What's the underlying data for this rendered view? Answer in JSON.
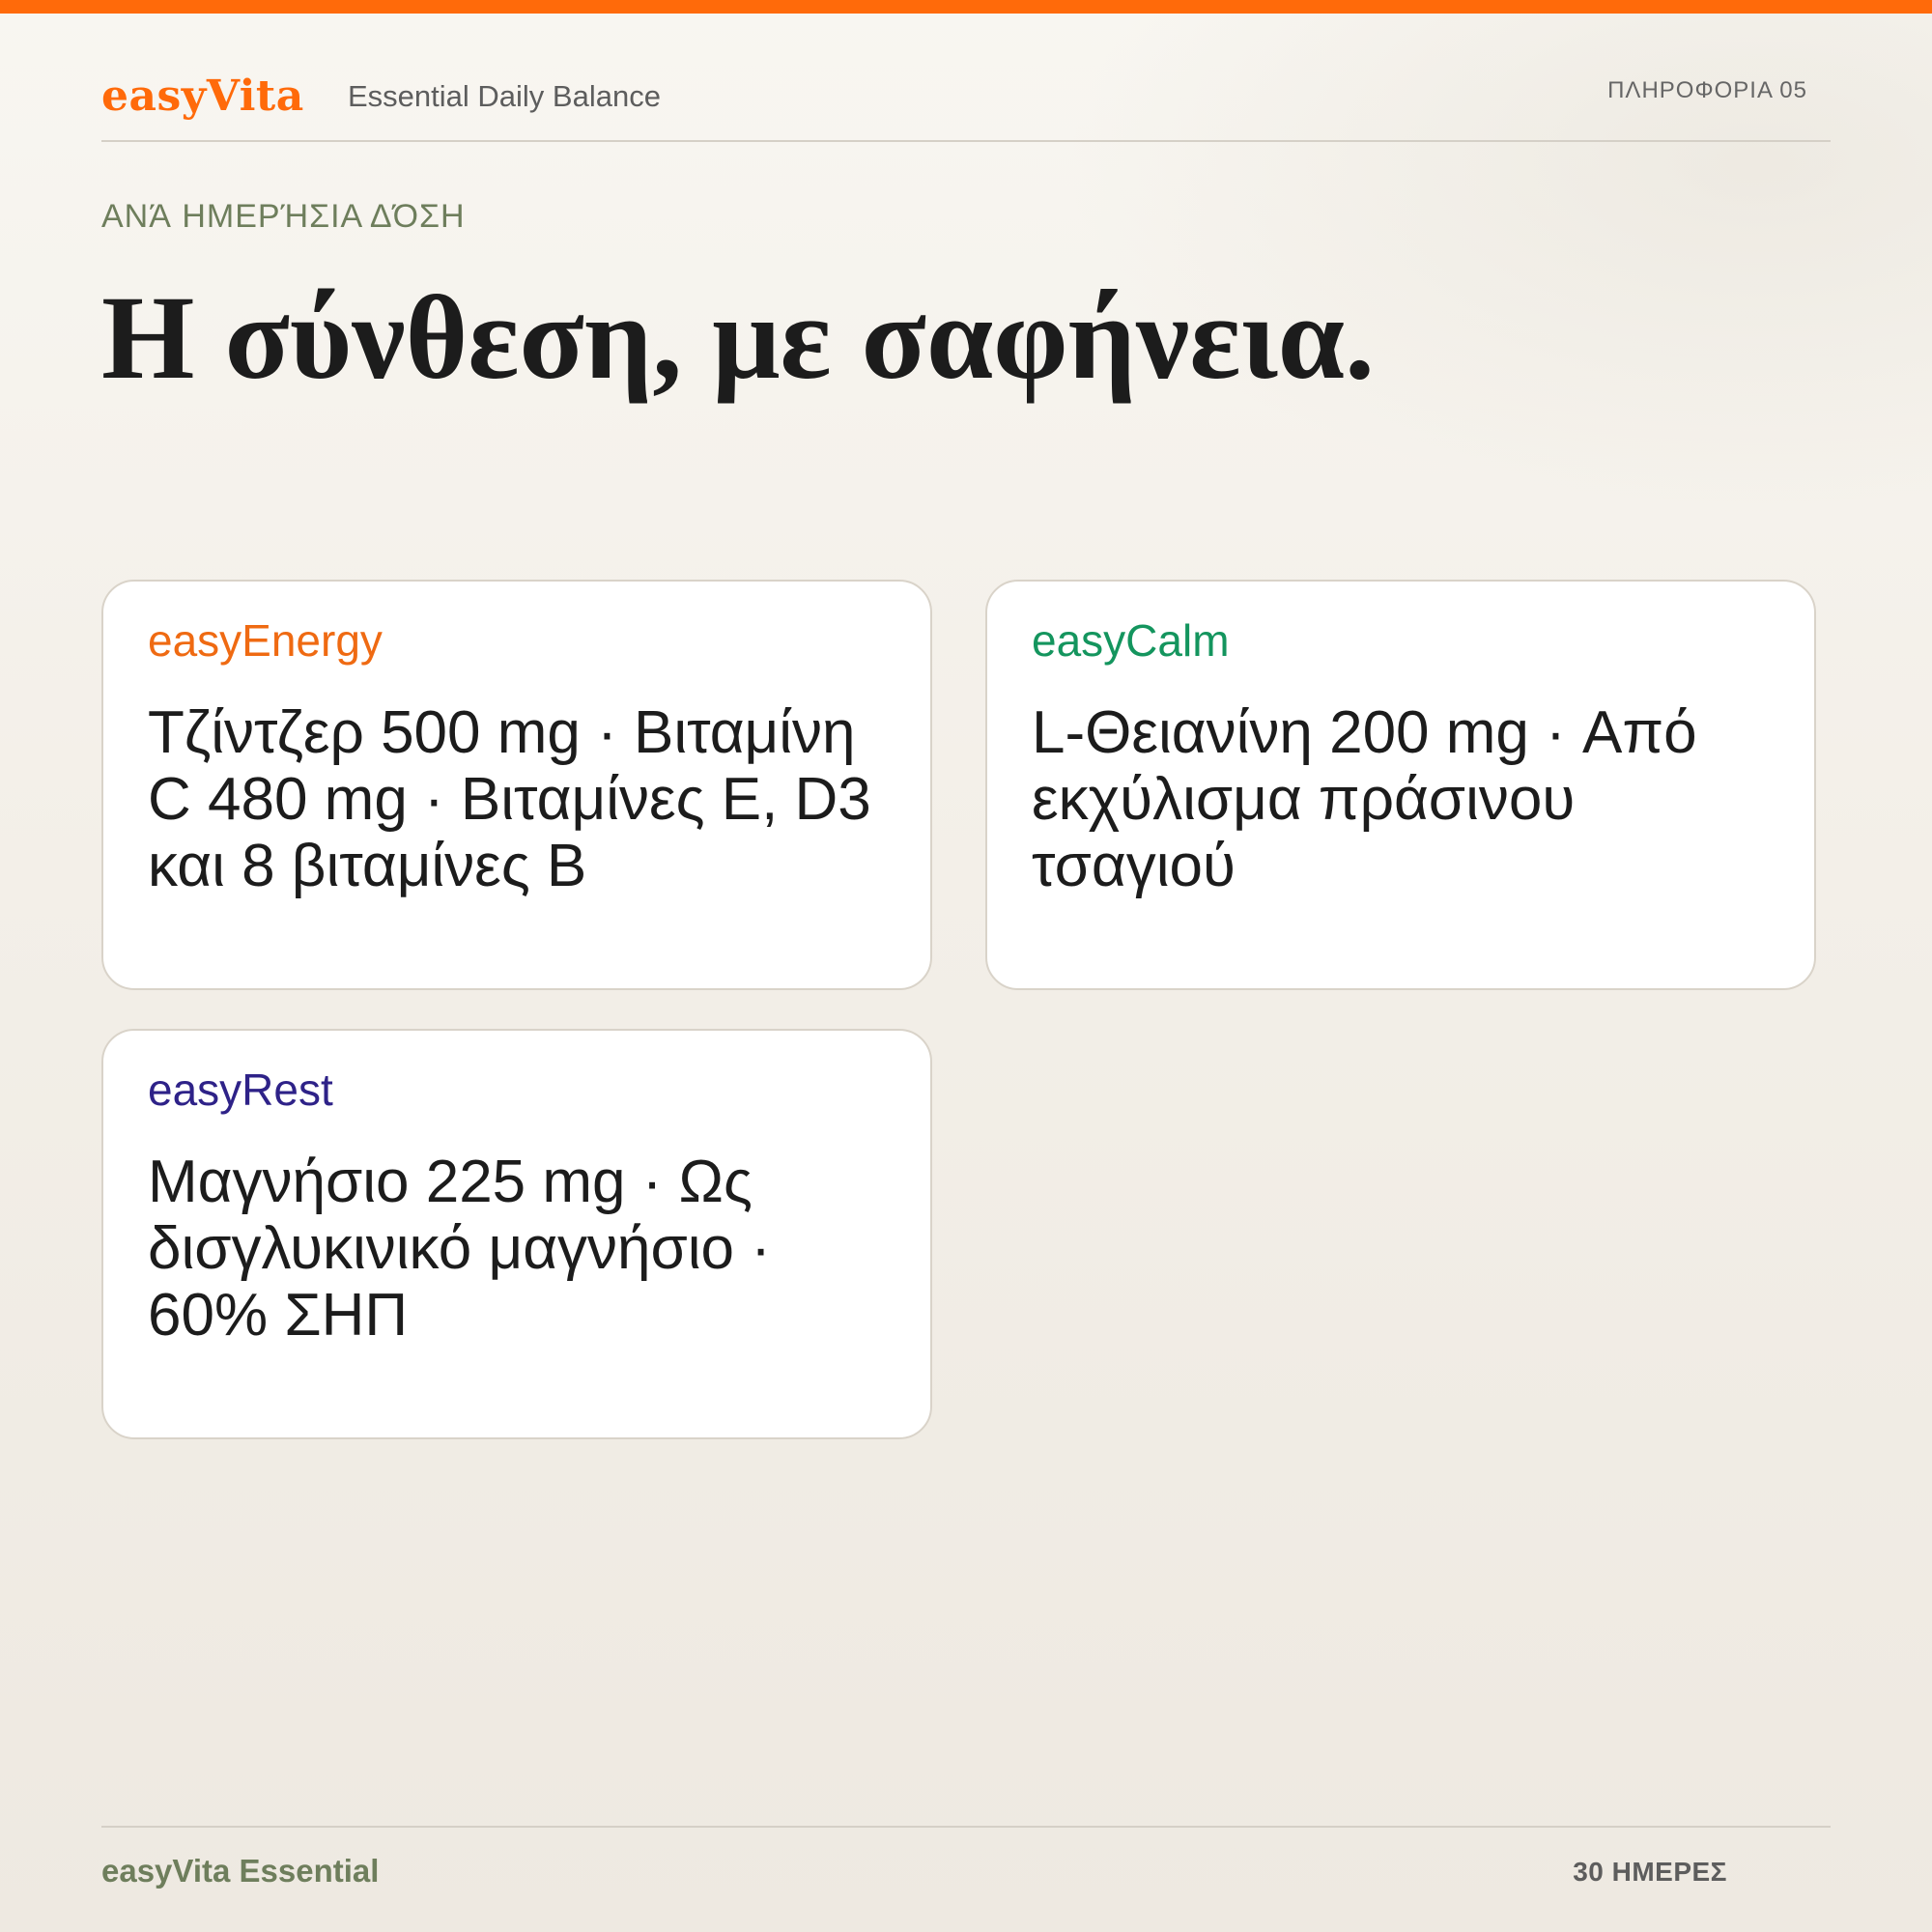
{
  "colors": {
    "accent": "#ff6a0a",
    "energy": "#ef6a12",
    "calm": "#14955e",
    "rest": "#2e2288",
    "olive": "#6e7e5c"
  },
  "header": {
    "logo": "easyVita",
    "tagline": "Essential Daily Balance",
    "section_code": "ΠΛΗΡΟΦΟΡΙΑ  05"
  },
  "main": {
    "eyebrow": "ΑΝΆ ΗΜΕΡΉΣΙΑ ΔΌΣΗ",
    "headline": "Η σύνθεση, με σαφήνεια.",
    "cards": [
      {
        "title": "easyEnergy",
        "body": "Τζίντζερ 500 mg · Βιταμίνη C 480 mg · Βιταμίνες Ε, D3 και 8 βιταμίνες Β"
      },
      {
        "title": "easyCalm",
        "body": "L-Θειανίνη 200 mg · Από εκχύλισμα πράσινου τσαγιού"
      },
      {
        "title": "easyRest",
        "body": "Μαγνήσιο 225 mg · Ως δισγλυκινικό μαγνήσιο · 60% ΣΗΠ"
      }
    ]
  },
  "footer": {
    "brand": "easyVita Essential",
    "days": "30 ΗΜΕΡΕΣ"
  }
}
